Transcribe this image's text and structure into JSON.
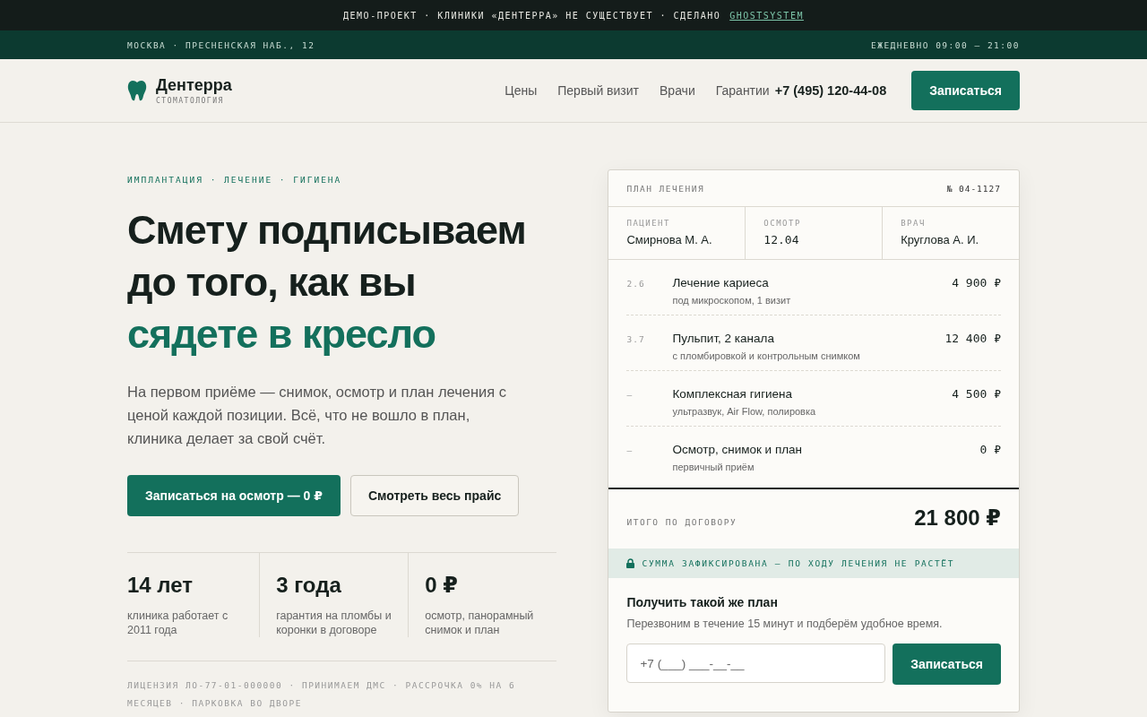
{
  "demo_bar": {
    "text": "ДЕМО-ПРОЕКТ · КЛИНИКИ «ДЕНТЕРРА» НЕ СУЩЕСТВУЕТ · СДЕЛАНО",
    "link": "GHOSTSYSTEM"
  },
  "info_bar": {
    "address": "МОСКВА · ПРЕСНЕНСКАЯ НАБ., 12",
    "hours": "ЕЖЕДНЕВНО 09:00 — 21:00"
  },
  "header": {
    "brand": "Дентерра",
    "tagline": "СТОМАТОЛОГИЯ",
    "nav": [
      "Цены",
      "Первый визит",
      "Врачи",
      "Гарантии"
    ],
    "phone": "+7 (495) 120-44-08",
    "cta": "Записаться"
  },
  "hero": {
    "eyebrow": "ИМПЛАНТАЦИЯ · ЛЕЧЕНИЕ · ГИГИЕНА",
    "title_lines": [
      "Смету подписываем",
      "до того, как вы"
    ],
    "title_accent": "сядете в кресло",
    "lead": "На первом приёме — снимок, осмотр и план лечения с ценой каждой позиции. Всё, что не вошло в план, клиника делает за свой счёт.",
    "primary_button": "Записаться на осмотр — 0 ₽",
    "secondary_button": "Смотреть весь прайс",
    "stats": [
      {
        "value": "14 лет",
        "caption": "клиника работает с 2011 года"
      },
      {
        "value": "3 года",
        "caption": "гарантия на пломбы и коронки в договоре"
      },
      {
        "value": "0 ₽",
        "caption": "осмотр, панорамный снимок и план"
      }
    ],
    "footnote": "ЛИЦЕНЗИЯ ЛО-77-01-000000 · ПРИНИМАЕМ ДМС · РАССРОЧКА 0% НА 6 МЕСЯЦЕВ · ПАРКОВКА ВО ДВОРЕ"
  },
  "plan": {
    "title": "ПЛАН ЛЕЧЕНИЯ",
    "number": "№ 04-1127",
    "meta": [
      {
        "label": "ПАЦИЕНТ",
        "value": "Смирнова М. А.",
        "kind": "text"
      },
      {
        "label": "ОСМОТР",
        "value": "12.04",
        "kind": "mono"
      },
      {
        "label": "ВРАЧ",
        "value": "Круглова А. И.",
        "kind": "text"
      }
    ],
    "items": [
      {
        "code": "2.6",
        "name": "Лечение кариеса",
        "note": "под микроскопом, 1 визит",
        "price": "4 900 ₽"
      },
      {
        "code": "3.7",
        "name": "Пульпит, 2 канала",
        "note": "с пломбировкой и контрольным снимком",
        "price": "12 400 ₽"
      },
      {
        "code": "–",
        "name": "Комплексная гигиена",
        "note": "ультразвук, Air Flow, полировка",
        "price": "4 500 ₽"
      },
      {
        "code": "–",
        "name": "Осмотр, снимок и план",
        "note": "первичный приём",
        "price": "0 ₽"
      }
    ],
    "total_label": "ИТОГО ПО ДОГОВОРУ",
    "total": "21 800 ₽",
    "lock_note": "СУММА ЗАФИКСИРОВАНА — ПО ХОДУ ЛЕЧЕНИЯ НЕ РАСТЁТ",
    "form_title": "Получить такой же план",
    "form_text": "Перезвоним в течение 15 минут и подберём удобное время.",
    "phone_placeholder": "+7 (___) ___-__-__",
    "submit": "Записаться"
  }
}
